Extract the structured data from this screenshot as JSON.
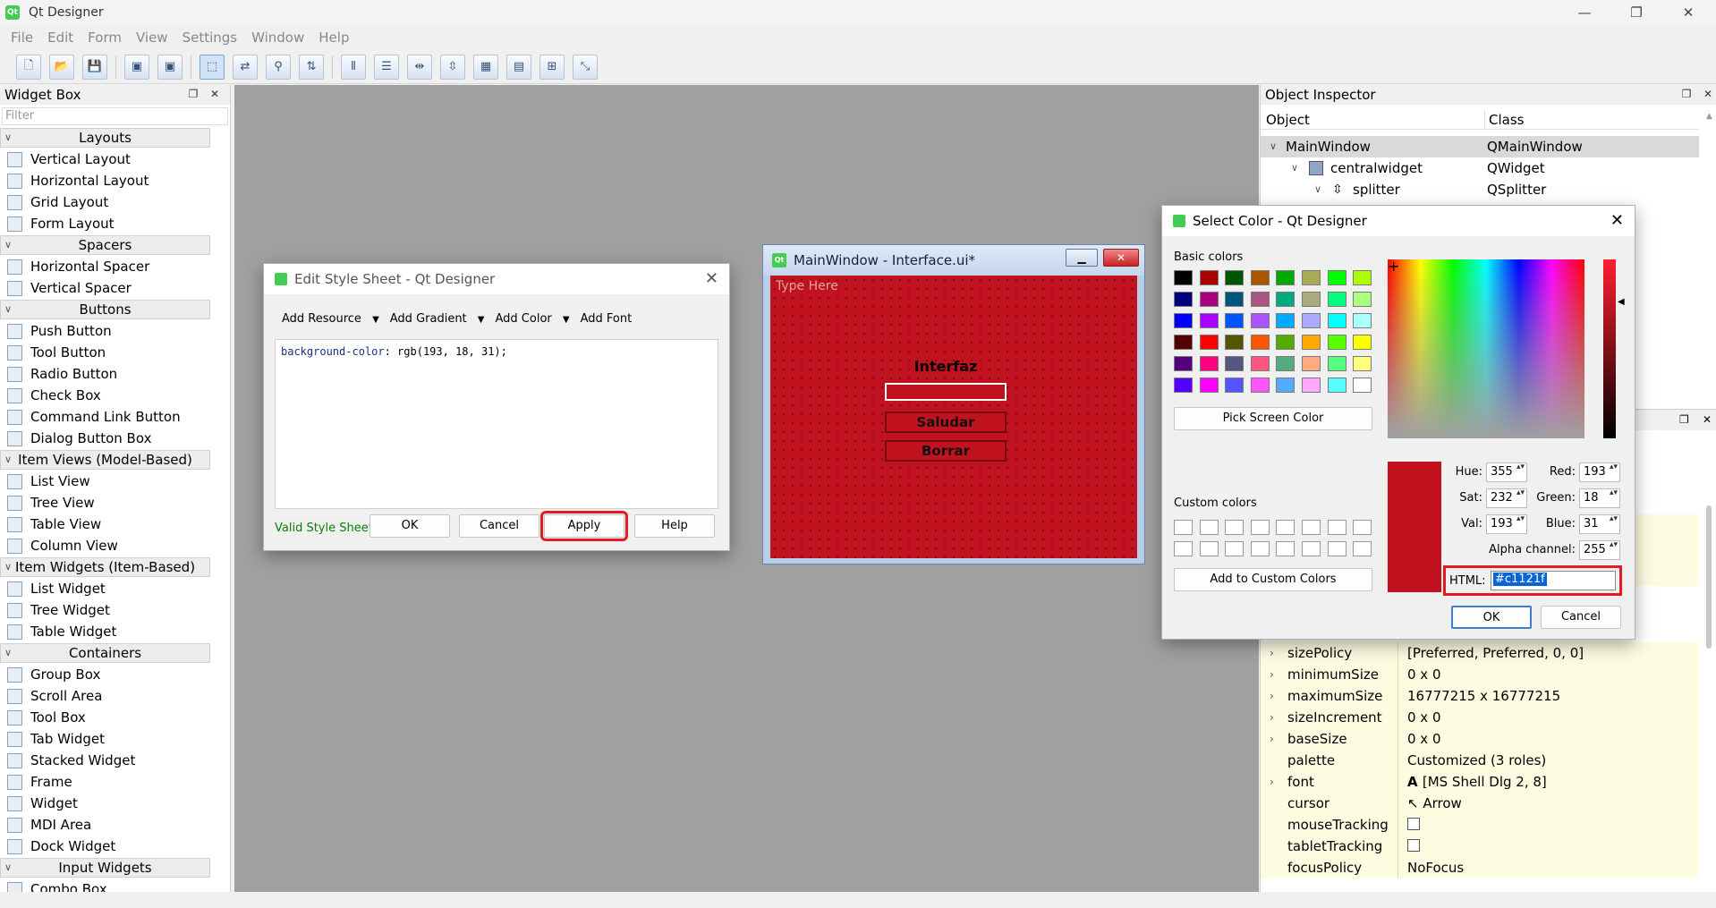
{
  "window": {
    "title": "Qt Designer",
    "min": "—",
    "max": "❐",
    "close": "✕"
  },
  "menu": [
    "File",
    "Edit",
    "Form",
    "View",
    "Settings",
    "Window",
    "Help"
  ],
  "widget_box": {
    "title": "Widget Box",
    "filter_placeholder": "Filter",
    "categories": [
      {
        "name": "Layouts",
        "items": [
          "Vertical Layout",
          "Horizontal Layout",
          "Grid Layout",
          "Form Layout"
        ]
      },
      {
        "name": "Spacers",
        "items": [
          "Horizontal Spacer",
          "Vertical Spacer"
        ]
      },
      {
        "name": "Buttons",
        "items": [
          "Push Button",
          "Tool Button",
          "Radio Button",
          "Check Box",
          "Command Link Button",
          "Dialog Button Box"
        ]
      },
      {
        "name": "Item Views (Model-Based)",
        "items": [
          "List View",
          "Tree View",
          "Table View",
          "Column View"
        ]
      },
      {
        "name": "Item Widgets (Item-Based)",
        "items": [
          "List Widget",
          "Tree Widget",
          "Table Widget"
        ]
      },
      {
        "name": "Containers",
        "items": [
          "Group Box",
          "Scroll Area",
          "Tool Box",
          "Tab Widget",
          "Stacked Widget",
          "Frame",
          "Widget",
          "MDI Area",
          "Dock Widget"
        ]
      },
      {
        "name": "Input Widgets",
        "items": [
          "Combo Box"
        ]
      }
    ]
  },
  "stylesheet_dialog": {
    "title": "Edit Style Sheet - Qt Designer",
    "menus": [
      "Add Resource",
      "Add Gradient",
      "Add Color",
      "Add Font"
    ],
    "css_property": "background-color",
    "css_value": ": rgb(193, 18, 31);",
    "status": "Valid Style Sheet",
    "buttons": {
      "ok": "OK",
      "cancel": "Cancel",
      "apply": "Apply",
      "help": "Help"
    }
  },
  "main_window": {
    "title": "MainWindow - Interface.ui*",
    "menu_placeholder": "Type Here",
    "label": "Interfaz",
    "button1": "Saludar",
    "button2": "Borrar",
    "bg_color": "#c1121f"
  },
  "object_inspector": {
    "title": "Object Inspector",
    "col_object": "Object",
    "col_class": "Class",
    "rows": [
      {
        "object": "MainWindow",
        "class": "QMainWindow"
      },
      {
        "object": "centralwidget",
        "class": "QWidget"
      },
      {
        "object": "splitter",
        "class": "QSplitter"
      }
    ]
  },
  "properties": [
    {
      "name": "sizePolicy",
      "value": "[Preferred, Preferred, 0, 0]",
      "expand": true
    },
    {
      "name": "minimumSize",
      "value": "0 x 0",
      "expand": true
    },
    {
      "name": "maximumSize",
      "value": "16777215 x 16777215",
      "expand": true
    },
    {
      "name": "sizeIncrement",
      "value": "0 x 0",
      "expand": true
    },
    {
      "name": "baseSize",
      "value": "0 x 0",
      "expand": true
    },
    {
      "name": "palette",
      "value": "Customized (3 roles)",
      "expand": false
    },
    {
      "name": "font",
      "value": "[MS Shell Dlg 2, 8]",
      "expand": true
    },
    {
      "name": "cursor",
      "value": "Arrow",
      "expand": false
    },
    {
      "name": "mouseTracking",
      "value": "",
      "expand": false
    },
    {
      "name": "tabletTracking",
      "value": "",
      "expand": false
    },
    {
      "name": "focusPolicy",
      "value": "NoFocus",
      "expand": false
    }
  ],
  "color_dialog": {
    "title": "Select Color - Qt Designer",
    "basic_label": "Basic colors",
    "pick_label": "Pick Screen Color",
    "custom_label": "Custom colors",
    "add_custom_label": "Add to Custom Colors",
    "hue_label": "Hue:",
    "hue": "355",
    "sat_label": "Sat:",
    "sat": "232",
    "val_label": "Val:",
    "val": "193",
    "red_label": "Red:",
    "red": "193",
    "green_label": "Green:",
    "green": "18",
    "blue_label": "Blue:",
    "blue": "31",
    "alpha_label": "Alpha channel:",
    "alpha": "255",
    "html_label": "HTML:",
    "html": "#c1121f",
    "ok": "OK",
    "cancel": "Cancel",
    "current_color": "#c1121f",
    "basic_colors": [
      "#000000",
      "#aa0000",
      "#005500",
      "#aa5500",
      "#00aa00",
      "#aaaa55",
      "#00ff00",
      "#aaff00",
      "#00007f",
      "#aa007f",
      "#00557f",
      "#aa557f",
      "#00aa7f",
      "#aaaa7f",
      "#00ff7f",
      "#aaff7f",
      "#0000ff",
      "#aa00ff",
      "#0055ff",
      "#aa55ff",
      "#00aaff",
      "#aaaaff",
      "#00ffff",
      "#aaffff",
      "#550000",
      "#ff0000",
      "#555500",
      "#ff5500",
      "#55aa00",
      "#ffaa00",
      "#55ff00",
      "#ffff00",
      "#55007f",
      "#ff007f",
      "#55557f",
      "#ff557f",
      "#55aa7f",
      "#ffaa7f",
      "#55ff7f",
      "#ffff7f",
      "#5500ff",
      "#ff00ff",
      "#5555ff",
      "#ff55ff",
      "#55aaff",
      "#ffaaff",
      "#55ffff",
      "#ffffff"
    ]
  }
}
